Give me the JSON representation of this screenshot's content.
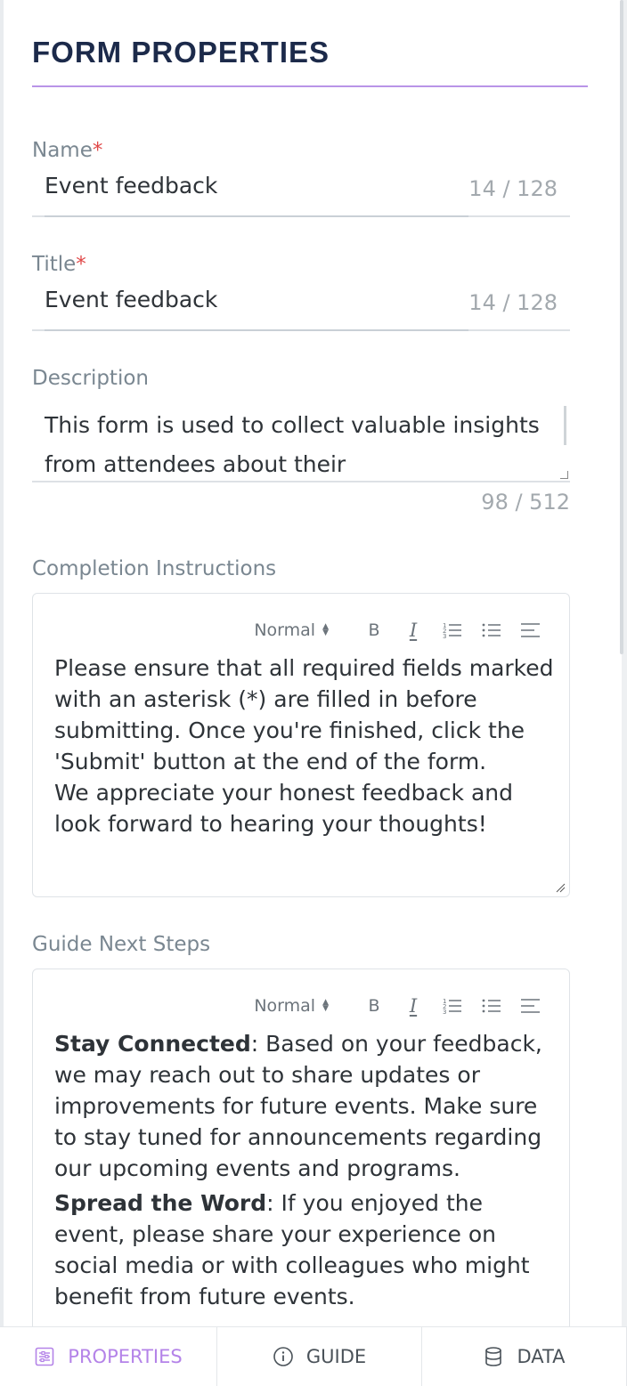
{
  "header": {
    "title": "FORM PROPERTIES"
  },
  "fields": {
    "name": {
      "label": "Name",
      "required_mark": "*",
      "value": "Event feedback",
      "count": "14 / 128"
    },
    "title": {
      "label": "Title",
      "required_mark": "*",
      "value": "Event feedback",
      "count": "14 / 128"
    },
    "description": {
      "label": "Description",
      "value": "This form is used to collect valuable insights from attendees about their",
      "count": "98 / 512"
    }
  },
  "toolbar": {
    "format_select": "Normal",
    "bold": "B",
    "italic": "I"
  },
  "completion_instructions": {
    "label": "Completion Instructions",
    "paragraphs": [
      "Please ensure that all required fields marked with an asterisk (*) are filled in before submitting. Once you're finished, click the 'Submit' button at the end of the form.",
      "We appreciate your honest feedback and look forward to hearing your thoughts!"
    ]
  },
  "guide_next_steps": {
    "label": "Guide Next Steps",
    "items": [
      {
        "bold": "Stay Connected",
        "text": ": Based on your feedback, we may reach out to share updates or improvements for future events. Make sure to stay tuned for announcements regarding our upcoming events and programs."
      },
      {
        "bold": "Spread the Word",
        "text": ": If you enjoyed the event, please share your experience on social media or with colleagues who might benefit from future events."
      }
    ]
  },
  "tabs": [
    {
      "label": "PROPERTIES",
      "icon": "sliders-icon",
      "active": true
    },
    {
      "label": "GUIDE",
      "icon": "info-circle-icon",
      "active": false
    },
    {
      "label": "DATA",
      "icon": "database-icon",
      "active": false
    }
  ],
  "colors": {
    "accent": "#b483e8",
    "title": "#1c2a4a",
    "required": "#e04848",
    "label": "#7a8791"
  }
}
